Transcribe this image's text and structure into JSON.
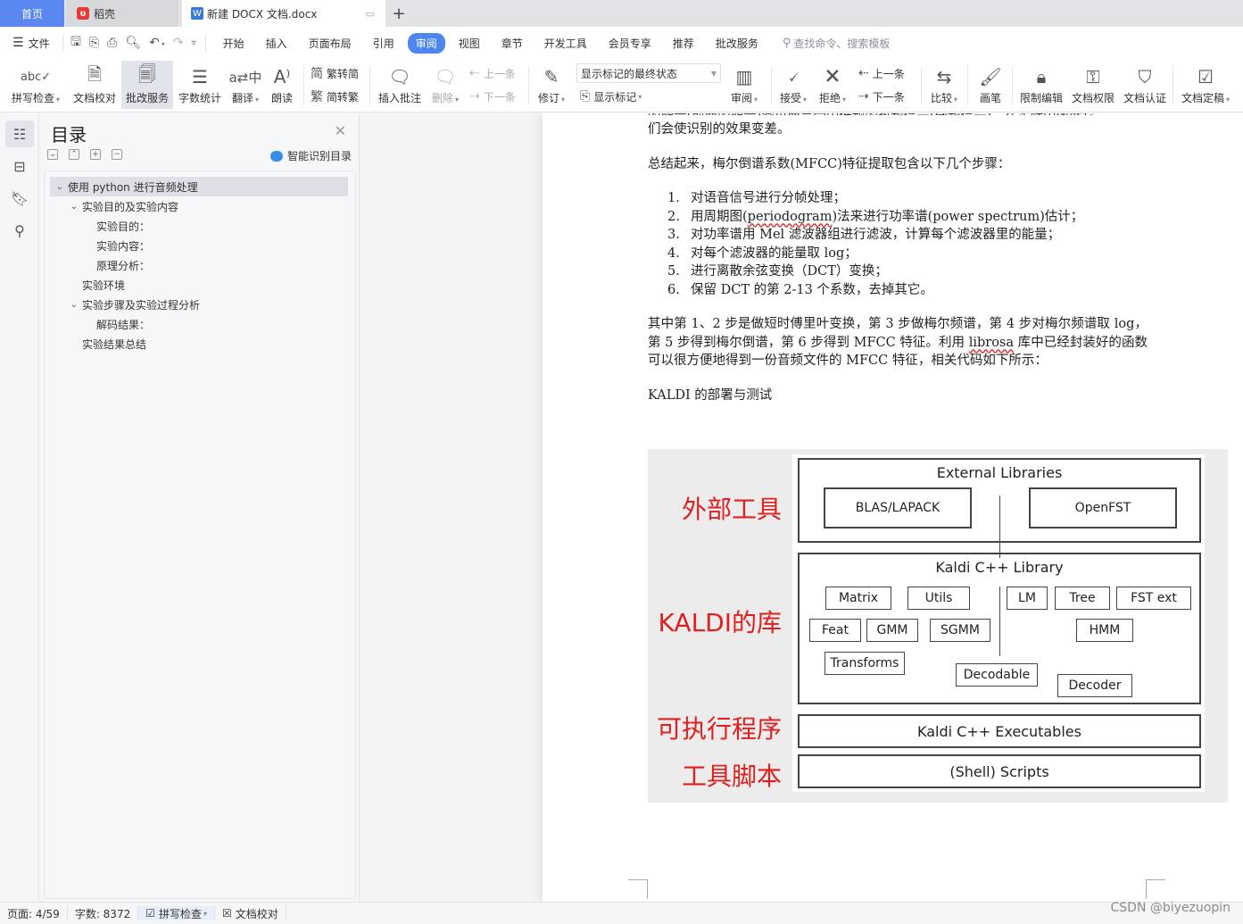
{
  "tabs": {
    "home": "首页",
    "daoke": "稻壳",
    "document": "新建 DOCX 文档.docx",
    "new_tab_icon": "plus-icon"
  },
  "menubar": {
    "file": "文件",
    "items": [
      "开始",
      "插入",
      "页面布局",
      "引用",
      "审阅",
      "视图",
      "章节",
      "开发工具",
      "会员专享",
      "推荐",
      "批改服务"
    ],
    "active": "审阅",
    "search_placeholder": "查找命令、搜索模板"
  },
  "ribbon": {
    "spell_check": "拼写检查",
    "doc_proof": "文档校对",
    "correction_service": "批改服务",
    "word_count": "字数统计",
    "translate": "翻译",
    "read_aloud": "朗读",
    "trad_to_simp": "繁转简",
    "simp_to_trad": "简转繁",
    "insert_comment": "插入批注",
    "delete": "删除",
    "prev_comment": "上一条",
    "next_comment": "下一条",
    "revise": "修订",
    "markup_state": "显示标记的最终状态",
    "show_markup": "显示标记",
    "review": "审阅",
    "accept": "接受",
    "reject": "拒绝",
    "prev_change": "上一条",
    "next_change": "下一条",
    "compare": "比较",
    "pen": "画笔",
    "restrict_edit": "限制编辑",
    "doc_permission": "文档权限",
    "doc_cert": "文档认证",
    "doc_finalize": "文档定稿"
  },
  "toc": {
    "title": "目录",
    "smart_label": "智能识别目录",
    "items": [
      {
        "label": "使用  python  进行音频处理",
        "level": 1,
        "expanded": true
      },
      {
        "label": "实验目的及实验内容",
        "level": 2,
        "expanded": true
      },
      {
        "label": "实验目的：",
        "level": 3
      },
      {
        "label": "实验内容：",
        "level": 3
      },
      {
        "label": "原理分析：",
        "level": 3
      },
      {
        "label": "实验环境",
        "level": 2
      },
      {
        "label": "实验步骤及实验过程分析",
        "level": 2,
        "expanded": true
      },
      {
        "label": "解码结果：",
        "level": 3
      },
      {
        "label": "实验结果总结",
        "level": 2
      }
    ]
  },
  "document": {
    "cut_line": "的能量(前面的能量)減小而是受中低频的热频信号(微频信号)，在实际中效就它",
    "para1": "们会使识别的效果变差。",
    "para2": "总结起来，梅尔倒谱系数(MFCC)特征提取包含以下几个步骤：",
    "steps": [
      {
        "num": "1.",
        "text": "对语音信号进行分帧处理；"
      },
      {
        "num": "2.",
        "pre": "用周期图(",
        "squig": "periodogram",
        "post": ")法来进行功率谱(power spectrum)估计；"
      },
      {
        "num": "3.",
        "text": "对功率谱用  Mel  滤波器组进行滤波，计算每个滤波器里的能量；"
      },
      {
        "num": "4.",
        "text": "对每个滤波器的能量取  log；"
      },
      {
        "num": "5.",
        "text": "进行离散余弦变换（DCT）变换；"
      },
      {
        "num": "6.",
        "text": "保留  DCT  的第  2-13  个系数，去掉其它。"
      }
    ],
    "para3_pre": "其中第  1、2  步是做短时傅里叶变换，第  3  步做梅尔频谱，第  4  步对梅尔频谱取  log，第  5 步得到梅尔倒谱，第  6  步得到  MFCC  特征。利用  ",
    "para3_squig": "librosa",
    "para3_post": "  库中已经封装好的函数可以很方便地得到一份音频文件的  MFCC  特征，相关代码如下所示：",
    "heading": "KALDI  的部署与测试"
  },
  "figure": {
    "labels": {
      "external": "外部工具",
      "library": "KALDI的库",
      "executables": "可执行程序",
      "scripts": "工具脚本"
    },
    "external_title": "External Libraries",
    "blas": "BLAS/LAPACK",
    "openfst": "OpenFST",
    "library_title": "Kaldi C++ Library",
    "modules": [
      "Matrix",
      "Utils",
      "LM",
      "Tree",
      "FST ext",
      "Feat",
      "GMM",
      "SGMM",
      "HMM",
      "Transforms",
      "Decodable",
      "Decoder"
    ],
    "executables_title": "Kaldi C++ Executables",
    "scripts_title": "(Shell) Scripts"
  },
  "status": {
    "page": "页面: 4/59",
    "words": "字数: 8372",
    "spell": "拼写检查",
    "proof": "文档校对"
  },
  "watermark": "CSDN @biyezuopin"
}
